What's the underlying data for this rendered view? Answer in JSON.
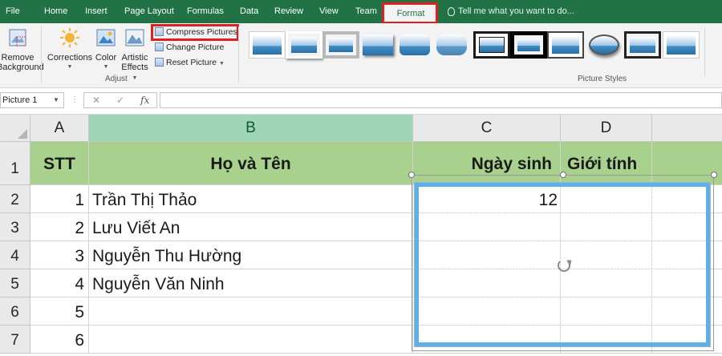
{
  "ribbon": {
    "tabs": [
      "File",
      "Home",
      "Insert",
      "Page Layout",
      "Formulas",
      "Data",
      "Review",
      "View",
      "Team"
    ],
    "active_tab": "Format",
    "tell_me": "Tell me what you want to do...",
    "remove_background": [
      "Remove",
      "Background"
    ],
    "corrections": "Corrections",
    "color": "Color",
    "artistic_effects": [
      "Artistic",
      "Effects"
    ],
    "compress_pictures": "Compress Pictures",
    "change_picture": "Change Picture",
    "reset_picture": "Reset Picture",
    "adjust_group": "Adjust",
    "picture_styles_group": "Picture Styles",
    "accent_color": "#217346",
    "highlight_color": "#e02020"
  },
  "formula_bar": {
    "name_box": "Picture 1",
    "cancel": "✕",
    "enter": "✓",
    "fx": "fx",
    "content": ""
  },
  "sheet": {
    "columns": [
      "A",
      "B",
      "C",
      "D"
    ],
    "rows": [
      "1",
      "2",
      "3",
      "4",
      "5",
      "6",
      "7"
    ],
    "header": {
      "stt": "STT",
      "name": "Họ và Tên",
      "dob": "Ngày sinh",
      "gender": "Giới tính"
    },
    "data": [
      {
        "stt": "1",
        "name": "Trần Thị Thảo",
        "dob": "12"
      },
      {
        "stt": "2",
        "name": "Lưu Viết An",
        "dob": ""
      },
      {
        "stt": "3",
        "name": "Nguyễn Thu Hường",
        "dob": ""
      },
      {
        "stt": "4",
        "name": "Nguyễn Văn Ninh",
        "dob": ""
      },
      {
        "stt": "5",
        "name": "",
        "dob": ""
      },
      {
        "stt": "6",
        "name": "",
        "dob": ""
      }
    ],
    "header_fill": "#a9d18e",
    "selected_column": "B"
  }
}
